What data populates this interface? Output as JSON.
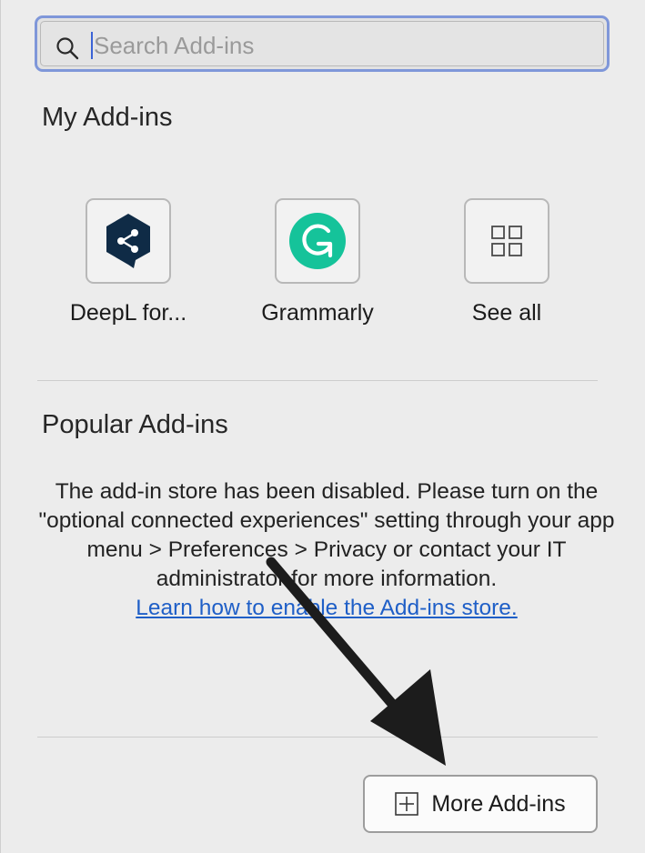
{
  "search": {
    "placeholder": "Search Add-ins",
    "value": ""
  },
  "my_addins": {
    "title": "My Add-ins",
    "items": [
      {
        "label": "DeepL for...",
        "icon": "deepl-icon"
      },
      {
        "label": "Grammarly",
        "icon": "grammarly-icon"
      },
      {
        "label": "See all",
        "icon": "grid-icon"
      }
    ]
  },
  "popular_addins": {
    "title": "Popular Add-ins",
    "message": "The add-in store has been disabled. Please turn on the \"optional connected experiences\" setting through your app menu > Preferences > Privacy or contact your IT administrator for more information.",
    "link": "Learn how to enable the Add-ins store."
  },
  "footer": {
    "more_button": "More Add-ins"
  },
  "colors": {
    "deepl": "#0f2b46",
    "grammarly": "#15c39a",
    "link": "#1f5fc7",
    "focus_ring": "#7f97d9"
  }
}
